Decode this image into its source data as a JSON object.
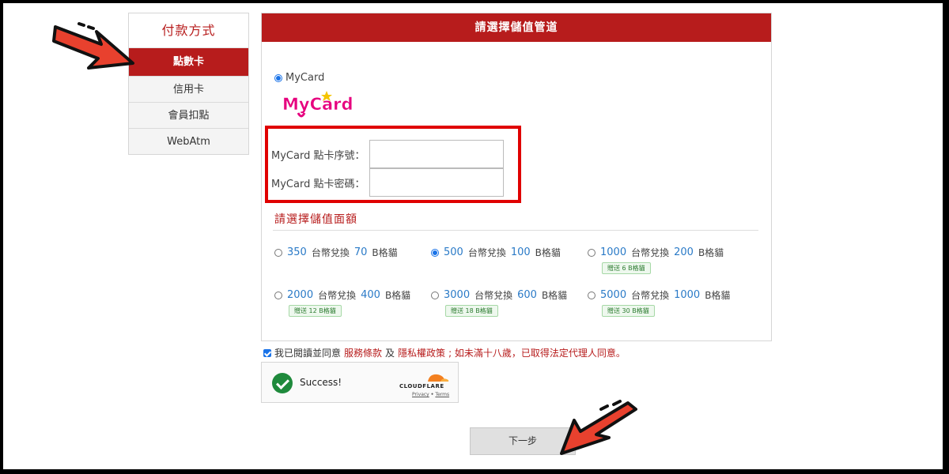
{
  "sidebar": {
    "title": "付款方式",
    "items": [
      {
        "label": "點數卡",
        "active": true
      },
      {
        "label": "信用卡",
        "active": false
      },
      {
        "label": "會員扣點",
        "active": false
      },
      {
        "label": "WebAtm",
        "active": false
      }
    ]
  },
  "panel": {
    "header": "請選擇儲值管道",
    "channel_label": "MyCard",
    "logo_text": "MyCard",
    "fields": {
      "serial_label": "MyCard 點卡序號：",
      "serial_value": "",
      "password_label": "MyCard 點卡密碼：",
      "password_value": ""
    },
    "amount_title": "請選擇儲值面額",
    "amounts": [
      {
        "ntd": "350",
        "mid": "台幣兌換",
        "coins": "70",
        "unit": "B格貓",
        "bonus": "",
        "selected": false
      },
      {
        "ntd": "500",
        "mid": "台幣兌換",
        "coins": "100",
        "unit": "B格貓",
        "bonus": "",
        "selected": true
      },
      {
        "ntd": "1000",
        "mid": "台幣兌換",
        "coins": "200",
        "unit": "B格貓",
        "bonus": "贈送 6 B格貓",
        "selected": false
      },
      {
        "ntd": "2000",
        "mid": "台幣兌換",
        "coins": "400",
        "unit": "B格貓",
        "bonus": "贈送 12 B格貓",
        "selected": false
      },
      {
        "ntd": "3000",
        "mid": "台幣兌換",
        "coins": "600",
        "unit": "B格貓",
        "bonus": "贈送 18 B格貓",
        "selected": false
      },
      {
        "ntd": "5000",
        "mid": "台幣兌換",
        "coins": "1000",
        "unit": "B格貓",
        "bonus": "贈送 30 B格貓",
        "selected": false
      }
    ]
  },
  "agreement": {
    "prefix": "我已閱讀並同意",
    "terms": "服務條款",
    "and": "及",
    "privacy": "隱私權政策",
    "suffix": "; 如未滿十八歲，已取得法定代理人同意。"
  },
  "cloudflare": {
    "status": "Success!",
    "brand": "CLOUDFLARE",
    "privacy": "Privacy",
    "separator": "•",
    "terms": "Terms"
  },
  "next_button": "下一步",
  "colors": {
    "brand_red": "#b71c1c",
    "highlight_red": "#e00000",
    "arrow_red": "#e8412e",
    "link_blue": "#2a7ac7"
  }
}
